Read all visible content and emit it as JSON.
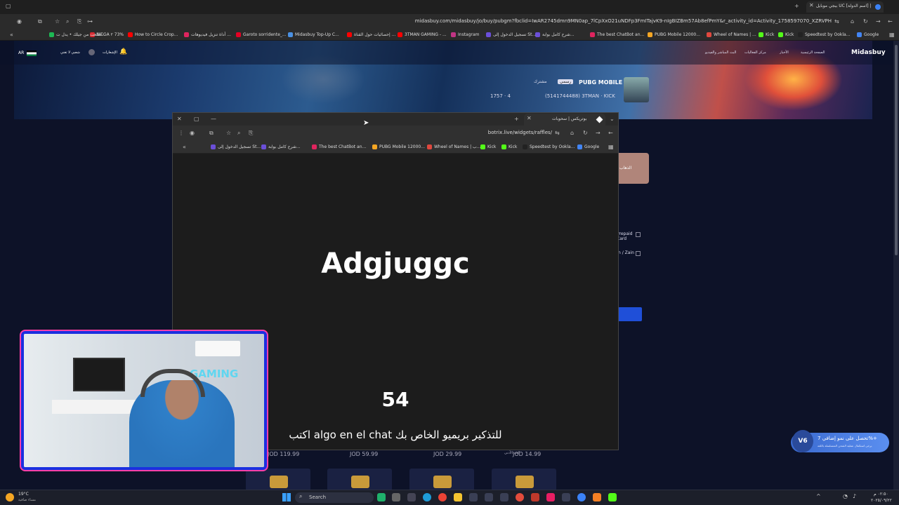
{
  "outer_browser": {
    "tab_title": "ببجي موبايل UC [اسم الدولة] | د...",
    "url": "midasbuy.com/midasbuy/jo/buy/pubgm?fbclid=IwAR2745dmn9MN0ap_7lCpXxO21uNDFp3FmITajvK9-nIgBIZBm57Ab8efPmY&r_activity_id=Activity_1758597070_XZRVPH",
    "bookmarks": [
      "Google",
      "Speedtest by Ookla...",
      "Kick",
      "Kick",
      "Wheel of Names | ...",
      "PUBG Mobile 12000...",
      "The best ChatBot an...",
      "شرح كامل بوابة...",
      "تسجيل الدخول إلى St...",
      "Instagram",
      "3TMAN GAMING - ...",
      "إحصائيات حول القناة ...",
      "Midasbuy Top-Up C...",
      "Garoto sorridente_...",
      "أداة تنزيل فيديوهات ...",
      "How to Circle Crop...",
      "MEGA ٢ 73%",
      "طلعت من جيلك • يدل ت..."
    ]
  },
  "midasbuy": {
    "logo": "Midasbuy",
    "nav": [
      "الصفحة الرئيسية",
      "الأخبار",
      "مركز الفعاليات",
      "البث المباشر والفيديو"
    ],
    "lang": "AR",
    "user": "شعبي لا تغني",
    "notifications_label": "الإشعارات",
    "game_name": "PUBG MOBILE",
    "game_tag": "رسمي",
    "game_badge": "مشترك",
    "player_id": "(5141744488) 3TMAN · KICK",
    "stats": "1757 · 4",
    "side_labels": [
      "Prepaid Card",
      "n / Zain"
    ],
    "side_button": "الذهاب",
    "prices": [
      "JOD 14.99",
      "JOD 29.99",
      "JOD 59.99",
      "JOD 119.99"
    ],
    "price_note": "الحد الأدنى",
    "promo_title": "تحصل على نمو إضافي 7%+",
    "promo_sub": "يرجى استكمال عملية الشحن المتسلسلة باللغة"
  },
  "inner_browser": {
    "tab_title": "بوتريكس | سحوبات",
    "url": "botrix.live/widgets/raffles/",
    "bookmarks": [
      "Google",
      "Speedtest by Ookla...",
      "Kick",
      "Kick",
      "Wheel of Names | ب...",
      "PUBG Mobile 12000...",
      "The best ChatBot an...",
      "شرح كامل بوابة...",
      "تسجيل الدخول إلى St..."
    ]
  },
  "raffle": {
    "name": "Adgjuggc",
    "count": "54",
    "instruction": "اكتب algo en el chat للتذكير بريميو الخاص بك"
  },
  "webcam": {
    "wall_text": "GAMING"
  },
  "taskbar": {
    "weather_temp": "19°C",
    "weather_desc": "مساء صافية",
    "search_placeholder": "Search",
    "time": "٠٢:٥٠ م",
    "date": "٢٠٢٥/٠٩/٢٢"
  }
}
